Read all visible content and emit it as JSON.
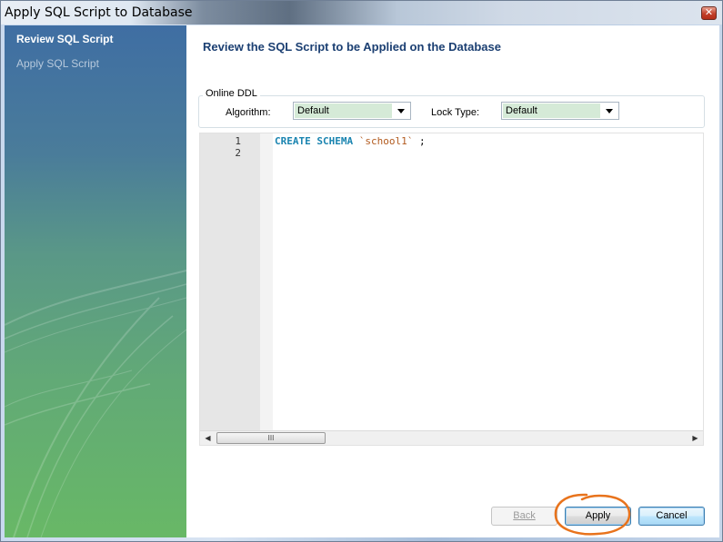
{
  "window": {
    "title": "Apply SQL Script to Database",
    "close_label": "✕"
  },
  "sidebar": {
    "steps": [
      {
        "label": "Review SQL Script",
        "active": true
      },
      {
        "label": "Apply SQL Script",
        "active": false
      }
    ]
  },
  "main": {
    "heading": "Review the SQL Script to be Applied on the Database",
    "online_ddl": {
      "legend": "Online DDL",
      "algorithm_label": "Algorithm:",
      "algorithm_value": "Default",
      "lock_type_label": "Lock Type:",
      "lock_type_value": "Default"
    },
    "editor": {
      "line_numbers": [
        "1",
        "2"
      ],
      "code_keyword": "CREATE SCHEMA",
      "code_identifier": "`school1`",
      "code_terminator": " ;",
      "scroll_thumb_label": "III"
    }
  },
  "buttons": {
    "back": "Back",
    "apply": "Apply",
    "cancel": "Cancel"
  },
  "colors": {
    "accent": "#1b3f72",
    "highlight_circle": "#e8731c",
    "keyword": "#1a84b0",
    "identifier": "#b25a1e"
  }
}
